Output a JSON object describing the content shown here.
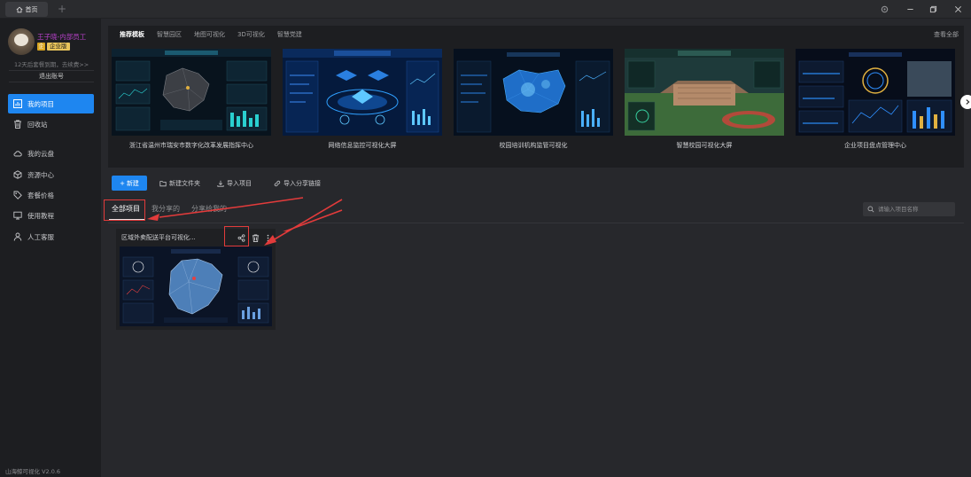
{
  "titlebar": {
    "home_tab": "首页",
    "add_tab": "+",
    "controls": [
      "settings-icon",
      "minimize-icon",
      "restore-icon",
      "close-icon"
    ]
  },
  "user": {
    "name": "王子晓-内部员工",
    "badge_icon": "企",
    "badge_label": "企业版",
    "expire_notice": "12天后套餐到期，去续费>>",
    "logout": "退出账号"
  },
  "sidebar": {
    "items": [
      {
        "label": "我的项目",
        "icon": "chart-icon",
        "active": true
      },
      {
        "label": "回收站",
        "icon": "trash-icon",
        "active": false
      },
      {
        "label": "我的云盘",
        "icon": "cloud-icon",
        "active": false
      },
      {
        "label": "资源中心",
        "icon": "cube-icon",
        "active": false
      },
      {
        "label": "套餐价格",
        "icon": "tag-icon",
        "active": false
      },
      {
        "label": "使用教程",
        "icon": "monitor-icon",
        "active": false
      },
      {
        "label": "人工客服",
        "icon": "person-icon",
        "active": false
      }
    ],
    "version": "山海鲸可视化 V2.0.6"
  },
  "templates": {
    "tabs": [
      "推荐模板",
      "智慧园区",
      "地图可视化",
      "3D可视化",
      "智慧党建"
    ],
    "active_tab": 0,
    "see_all": "查看全部",
    "cards": [
      {
        "title": "浙江省温州市瑞安市数字化改革发展指挥中心"
      },
      {
        "title": "网络信息监控可视化大屏"
      },
      {
        "title": "校园培训机构监管可视化"
      },
      {
        "title": "智慧校园可视化大屏"
      },
      {
        "title": "企业项目盘点管理中心"
      }
    ]
  },
  "toolbar": {
    "new": "新建",
    "new_folder": "新建文件夹",
    "import_project": "导入项目",
    "import_share": "导入分享链接"
  },
  "filters": [
    "全部项目",
    "我分享的",
    "分享给我的"
  ],
  "active_filter": 0,
  "search": {
    "placeholder": "请输入项目名称"
  },
  "project": {
    "title": "区域外卖配送平台可视化..."
  },
  "colors": {
    "accent": "#1e86f0",
    "highlight": "#e23b3b",
    "background": "#27282c"
  }
}
